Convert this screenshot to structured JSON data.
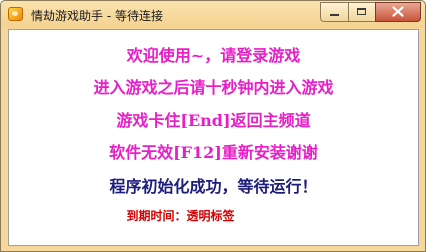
{
  "window": {
    "title": "情劫游戏助手 - 等待连接"
  },
  "messages": {
    "line1": "欢迎使用~，请登录游戏",
    "line2": "进入游戏之后请十秒钟内进入游戏",
    "line3": "游戏卡住[End]返回主频道",
    "line4": "软件无效[F12]重新安装谢谢",
    "status": "程序初始化成功，等待运行！",
    "expire": "到期时间：透明标签"
  },
  "colors": {
    "message": "#e81ec8",
    "status": "#1c1c7a",
    "expire": "#d40000",
    "frame": "#f5d79c"
  }
}
